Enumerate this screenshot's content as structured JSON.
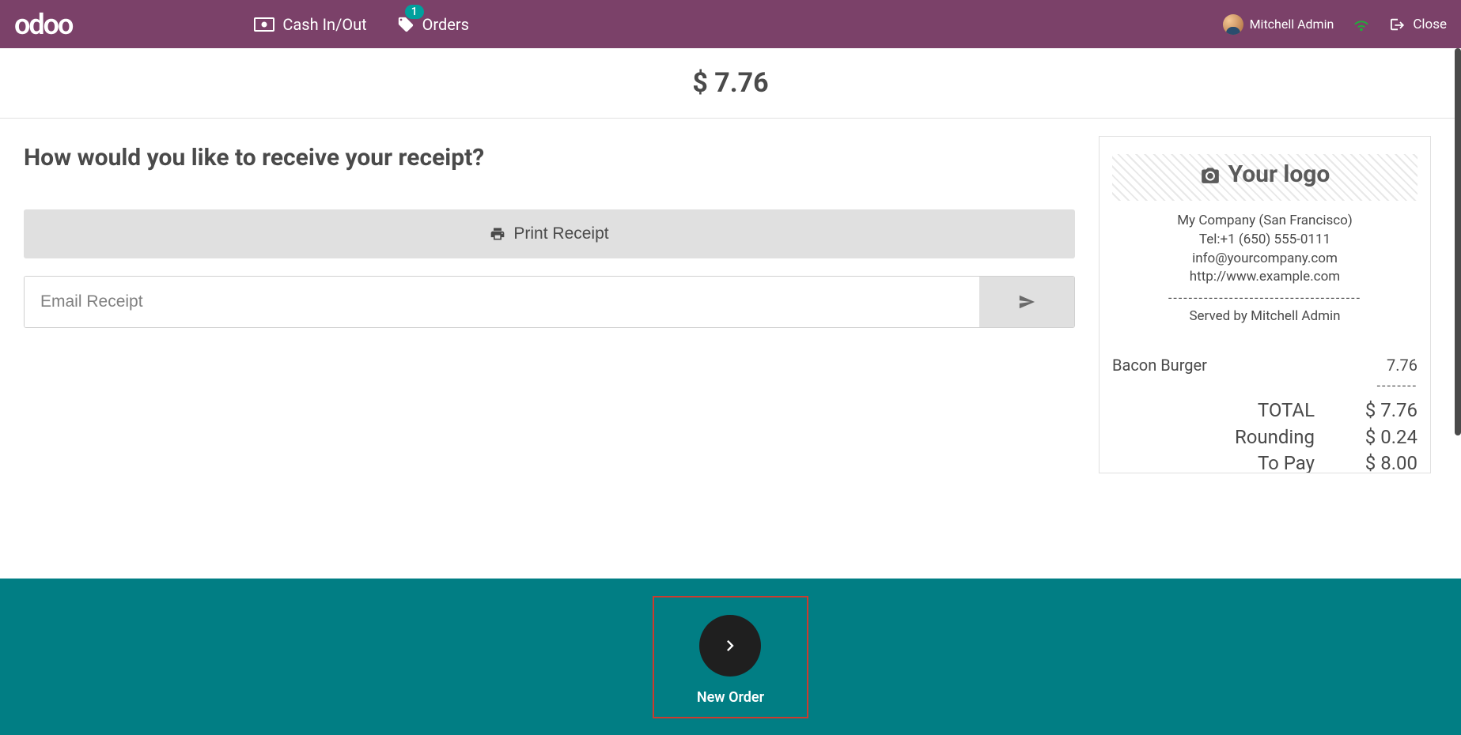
{
  "header": {
    "logo": "odoo",
    "cash_label": "Cash In/Out",
    "orders_label": "Orders",
    "orders_badge": "1",
    "user_name": "Mitchell Admin",
    "close_label": "Close"
  },
  "amount": "$ 7.76",
  "receipt_question": "How would you like to receive your receipt?",
  "print_button_label": "Print Receipt",
  "email_placeholder": "Email Receipt",
  "receipt": {
    "logo_text": "Your logo",
    "company_name": "My Company (San Francisco)",
    "tel": "Tel:+1 (650) 555-0111",
    "email": "info@yourcompany.com",
    "website": "http://www.example.com",
    "served_by": "Served by Mitchell Admin",
    "items": [
      {
        "name": "Bacon Burger",
        "price": "7.76"
      }
    ],
    "totals": [
      {
        "label": "TOTAL",
        "value": "$ 7.76"
      },
      {
        "label": "Rounding",
        "value": "$ 0.24"
      },
      {
        "label": "To Pay",
        "value": "$ 8.00"
      }
    ]
  },
  "new_order_label": "New Order"
}
